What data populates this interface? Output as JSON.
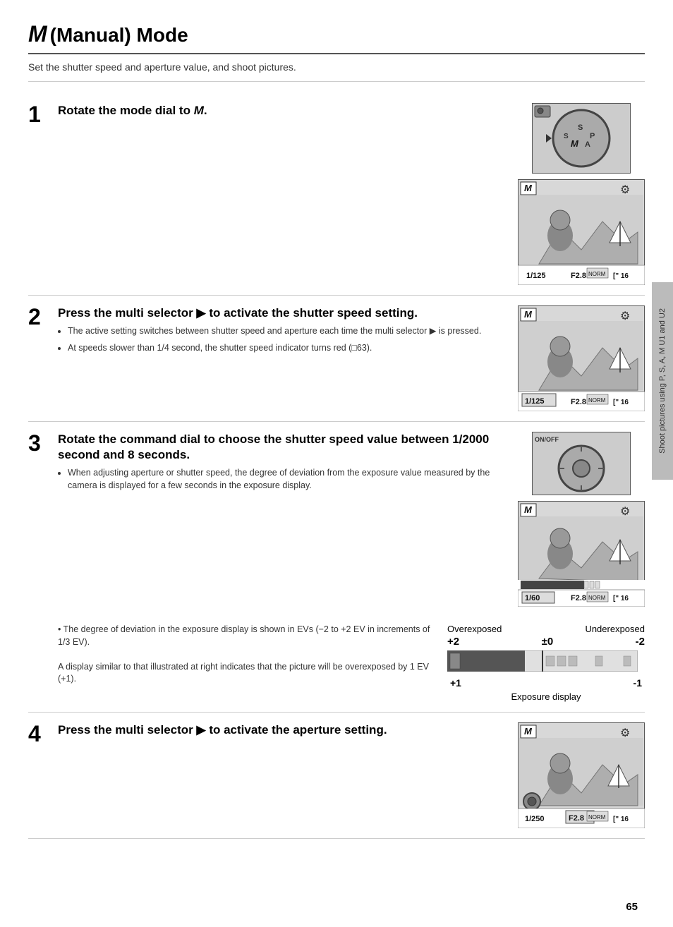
{
  "page": {
    "title_m": "M",
    "title_rest": " (Manual) Mode",
    "intro": "Set the shutter speed and aperture value, and shoot pictures.",
    "page_number": "65",
    "sidebar_text": "Shoot pictures using P, S, A, M U1 and U2"
  },
  "steps": [
    {
      "number": "1",
      "heading": "Rotate the mode dial to M.",
      "bullets": [],
      "extra": ""
    },
    {
      "number": "2",
      "heading": "Press the multi selector ▶ to activate the shutter speed setting.",
      "bullets": [
        "The active setting switches between shutter speed and aperture each time the multi selector ▶ is pressed.",
        "At speeds slower than 1/4 second, the shutter speed indicator turns red (□63)."
      ],
      "extra": ""
    },
    {
      "number": "3",
      "heading": "Rotate the command dial to choose the shutter speed value between 1/2000 second and 8 seconds.",
      "bullets": [
        "When adjusting aperture or shutter speed, the degree of deviation from the exposure value measured by the camera is displayed for a few seconds in the exposure display."
      ],
      "extra": "• The degree of deviation in the exposure display is shown in EVs (−2 to +2 EV in increments of 1/3 EV).\nA display similar to that illustrated at right indicates that the picture will be overexposed by 1 EV (+1)."
    },
    {
      "number": "4",
      "heading": "Press the multi selector ▶ to activate the aperture setting.",
      "bullets": [],
      "extra": ""
    }
  ],
  "lcd_screens": {
    "screen1": {
      "m_badge": "M",
      "shutter": "1/125",
      "aperture": "F2.8",
      "extra": "16"
    },
    "screen2": {
      "m_badge": "M",
      "shutter": "1/125",
      "aperture": "F2.8",
      "extra": "16"
    },
    "screen3": {
      "m_badge": "M",
      "shutter": "1/60",
      "aperture": "F2.8",
      "extra": "16"
    },
    "screen4": {
      "m_badge": "M",
      "shutter": "1/250",
      "aperture": "F2.8",
      "extra": "16"
    }
  },
  "exposure_display": {
    "label_left": "Overexposed",
    "label_right": "Underexposed",
    "val_left": "+2",
    "val_mid": "±0",
    "val_right": "-2",
    "ind_left": "+1",
    "ind_right": "-1",
    "title": "Exposure display"
  }
}
